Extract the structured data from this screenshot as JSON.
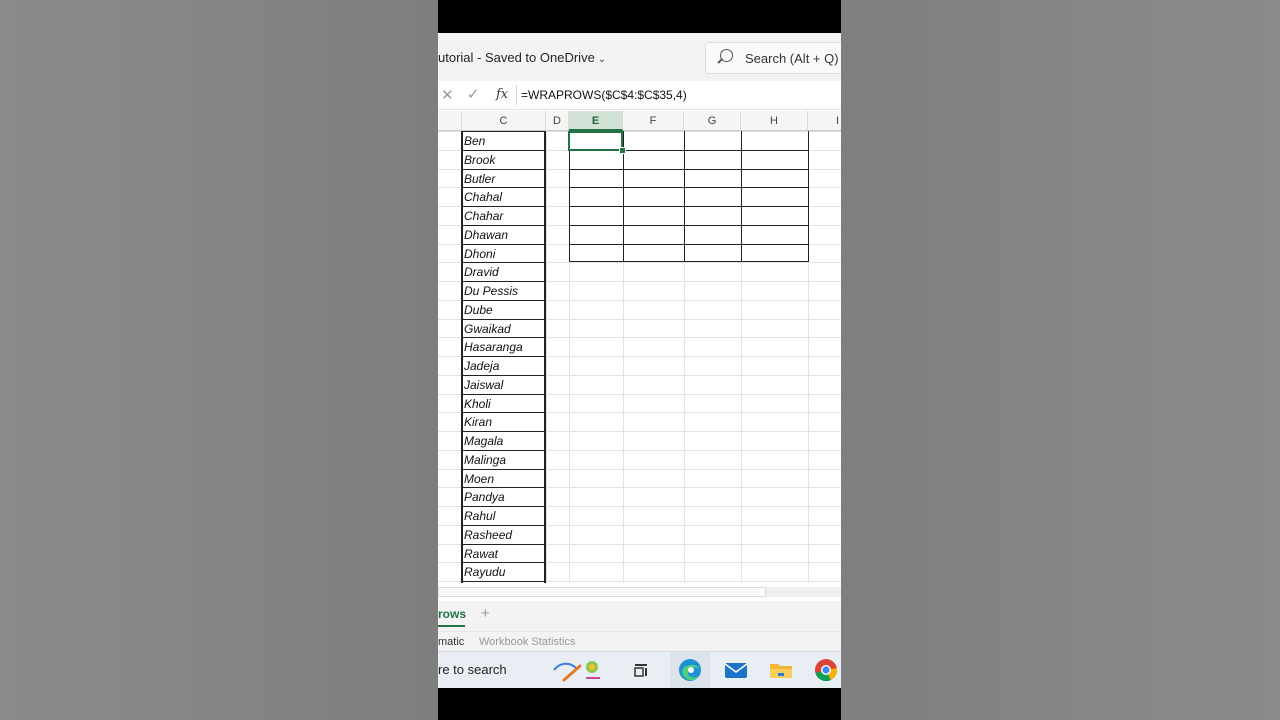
{
  "titlebar": {
    "title": "utorial  -  Saved to OneDrive",
    "search_placeholder": "Search (Alt + Q)"
  },
  "formula_bar": {
    "fx_label": "fx",
    "formula": "=WRAPROWS($C$4:$C$35,4)"
  },
  "columns": [
    "C",
    "D",
    "E",
    "F",
    "G",
    "H",
    "I"
  ],
  "active_column": "E",
  "names": [
    "Ben",
    "Brook",
    "Butler",
    "Chahal",
    "Chahar",
    "Dhawan",
    "Dhoni",
    "Dravid",
    "Du Pessis",
    "Dube",
    "Gwaikad",
    "Hasaranga",
    "Jadeja",
    "Jaiswal",
    "Kholi",
    "Kiran",
    "Magala",
    "Malinga",
    "Moen",
    "Pandya",
    "Rahul",
    "Rasheed",
    "Rawat",
    "Rayudu"
  ],
  "sheet": {
    "tab_label": "rows",
    "add_label": "+"
  },
  "status": {
    "left": "matic",
    "stats": "Workbook Statistics"
  },
  "taskbar": {
    "search_text": "re to search",
    "apps": [
      "task-view",
      "edge",
      "mail",
      "file-explorer",
      "chrome"
    ]
  },
  "colors": {
    "excel_green": "#217346",
    "titlebar_bg": "#f3f3f3",
    "taskbar_bg": "#e9eef5"
  }
}
